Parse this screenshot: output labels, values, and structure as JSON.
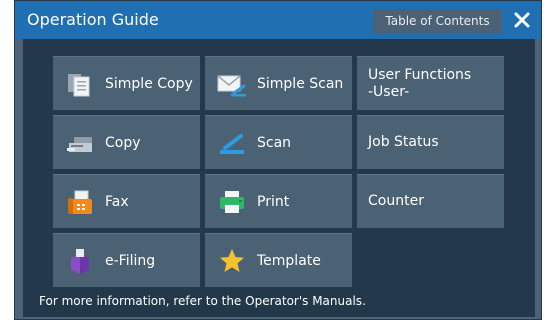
{
  "header": {
    "title": "Operation Guide",
    "toc_label": "Table of Contents",
    "close_icon": "close-icon"
  },
  "tiles": [
    {
      "label": "Simple Copy",
      "icon": "simple-copy-icon"
    },
    {
      "label": "Simple Scan",
      "icon": "simple-scan-icon"
    },
    {
      "label": "User Functions\n-User-",
      "icon": ""
    },
    {
      "label": "Copy",
      "icon": "copy-icon"
    },
    {
      "label": "Scan",
      "icon": "scan-icon"
    },
    {
      "label": "Job Status",
      "icon": ""
    },
    {
      "label": "Fax",
      "icon": "fax-icon"
    },
    {
      "label": "Print",
      "icon": "print-icon"
    },
    {
      "label": "Counter",
      "icon": ""
    },
    {
      "label": "e-Filing",
      "icon": "e-filing-icon"
    },
    {
      "label": "Template",
      "icon": "template-star-icon"
    }
  ],
  "footer": {
    "text": "For more information, refer to the Operator's Manuals."
  },
  "colors": {
    "header_bar": "#1f6fb2",
    "panel": "#24384b",
    "tile": "#4b6174",
    "star": "#f5c12e"
  }
}
